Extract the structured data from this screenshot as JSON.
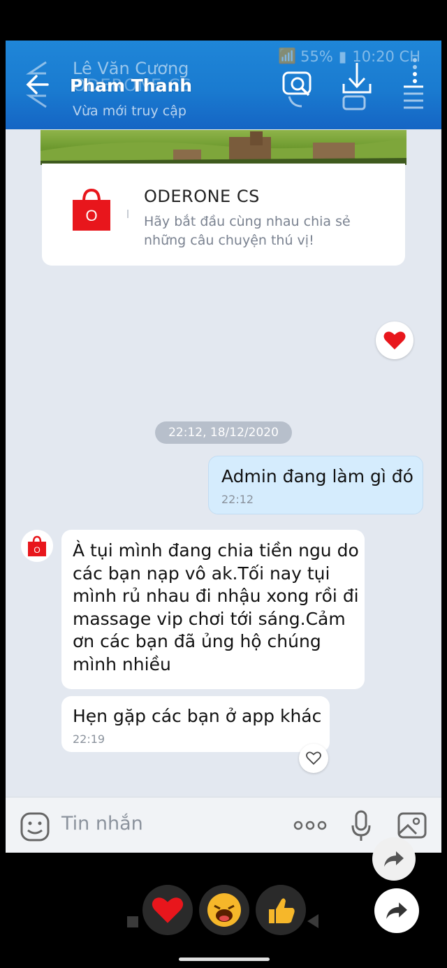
{
  "status_bar": {
    "battery": "55%",
    "time": "10:20 CH"
  },
  "header": {
    "ghost_name": "Lê Văn Cương",
    "ghost_name2": "ODERONE CS",
    "contact_name": "Pham Thanh",
    "presence": "Vừa mới truy cập"
  },
  "card": {
    "title": "ODERONE CS",
    "description": "Hãy bắt đầu cùng nhau chia sẻ những câu chuyện thú vị!",
    "logo_letter": "O"
  },
  "date_separator": "22:12, 18/12/2020",
  "messages": [
    {
      "direction": "out",
      "text": "Admin đang làm gì đó",
      "time": "22:12"
    },
    {
      "direction": "in",
      "text": "À tụi mình đang chia tiền ngu do các bạn nạp vô ak.Tối nay tụi mình rủ nhau đi nhậu xong rồi đi massage vip chơi tới sáng.Cảm ơn các bạn đã ủng hộ chúng mình nhiều",
      "time": ""
    },
    {
      "direction": "in",
      "text": "Hẹn gặp các bạn ở app khác",
      "time": "22:19"
    }
  ],
  "input": {
    "placeholder": "Tin nhắn",
    "more_label": "ooo"
  },
  "colors": {
    "header": "#1a7bd0",
    "bubble_out": "#d5ecfd",
    "bubble_in": "#ffffff",
    "chat_bg": "#e3e8f0",
    "brand_red": "#e8161c"
  },
  "icons": [
    "back-arrow-icon",
    "call-search-icon",
    "download-icon",
    "menu-list-icon",
    "heart-icon",
    "sticker-icon",
    "more-icon",
    "mic-icon",
    "image-icon",
    "share-icon",
    "laugh-emoji-icon",
    "thumbs-up-icon"
  ]
}
